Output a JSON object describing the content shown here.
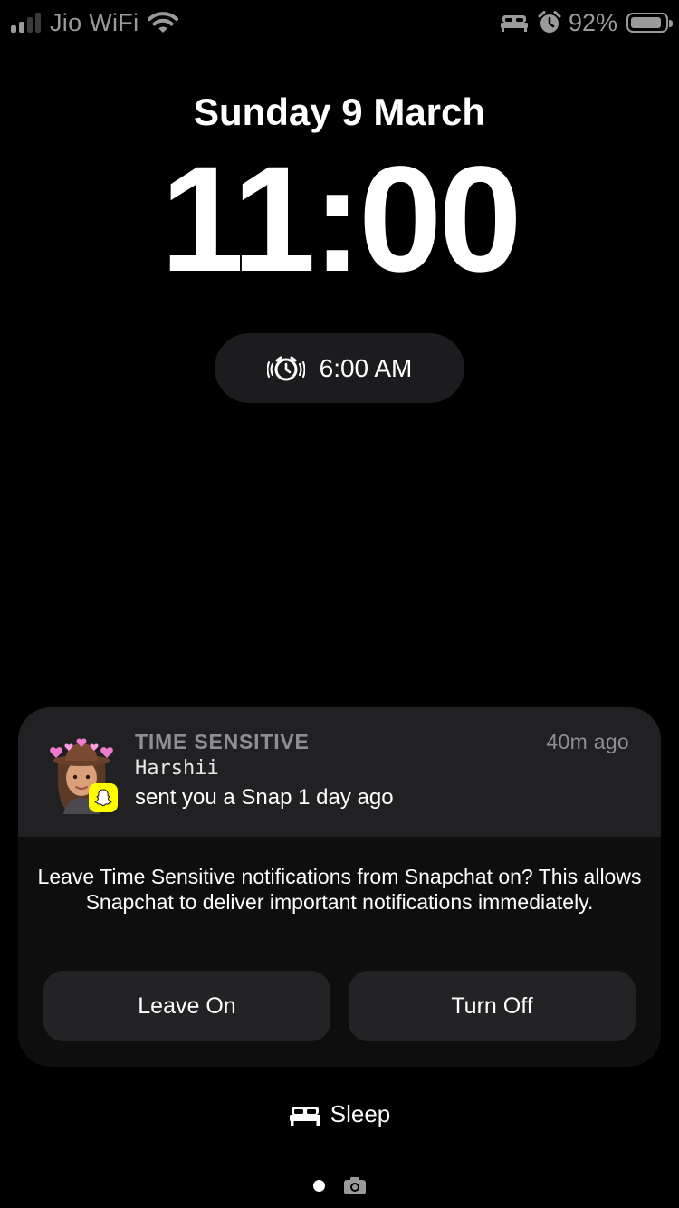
{
  "status_bar": {
    "carrier": "Jio WiFi",
    "signal_bars_active": 2,
    "signal_bars_total": 4,
    "battery_percent": "92%",
    "battery_level": 0.92,
    "icons": [
      "signal-icon",
      "wifi-icon",
      "bed-icon",
      "alarm-clock-icon",
      "battery-icon"
    ],
    "color": "#9a9a9a"
  },
  "lock_screen": {
    "date": "Sunday 9 March",
    "time": "11:00"
  },
  "alarm": {
    "icon": "alarm-clock-ringing-icon",
    "time": "6:00 AM"
  },
  "notification": {
    "app_icon": "snapchat-ghost-icon",
    "avatar": "bitmoji-avatar",
    "category": "TIME SENSITIVE",
    "timestamp": "40m ago",
    "sender": "Harshii",
    "message": "sent you a Snap 1 day ago",
    "prompt": "Leave Time Sensitive notifications from Snapchat on? This allows Snapchat to deliver important notifications immediately.",
    "buttons": {
      "leave_on": "Leave On",
      "turn_off": "Turn Off"
    },
    "accent_color": "#fffc00"
  },
  "sleep": {
    "icon": "bed-icon",
    "label": "Sleep"
  },
  "page_indicator": {
    "icons": [
      "page-dot",
      "camera-icon"
    ]
  }
}
